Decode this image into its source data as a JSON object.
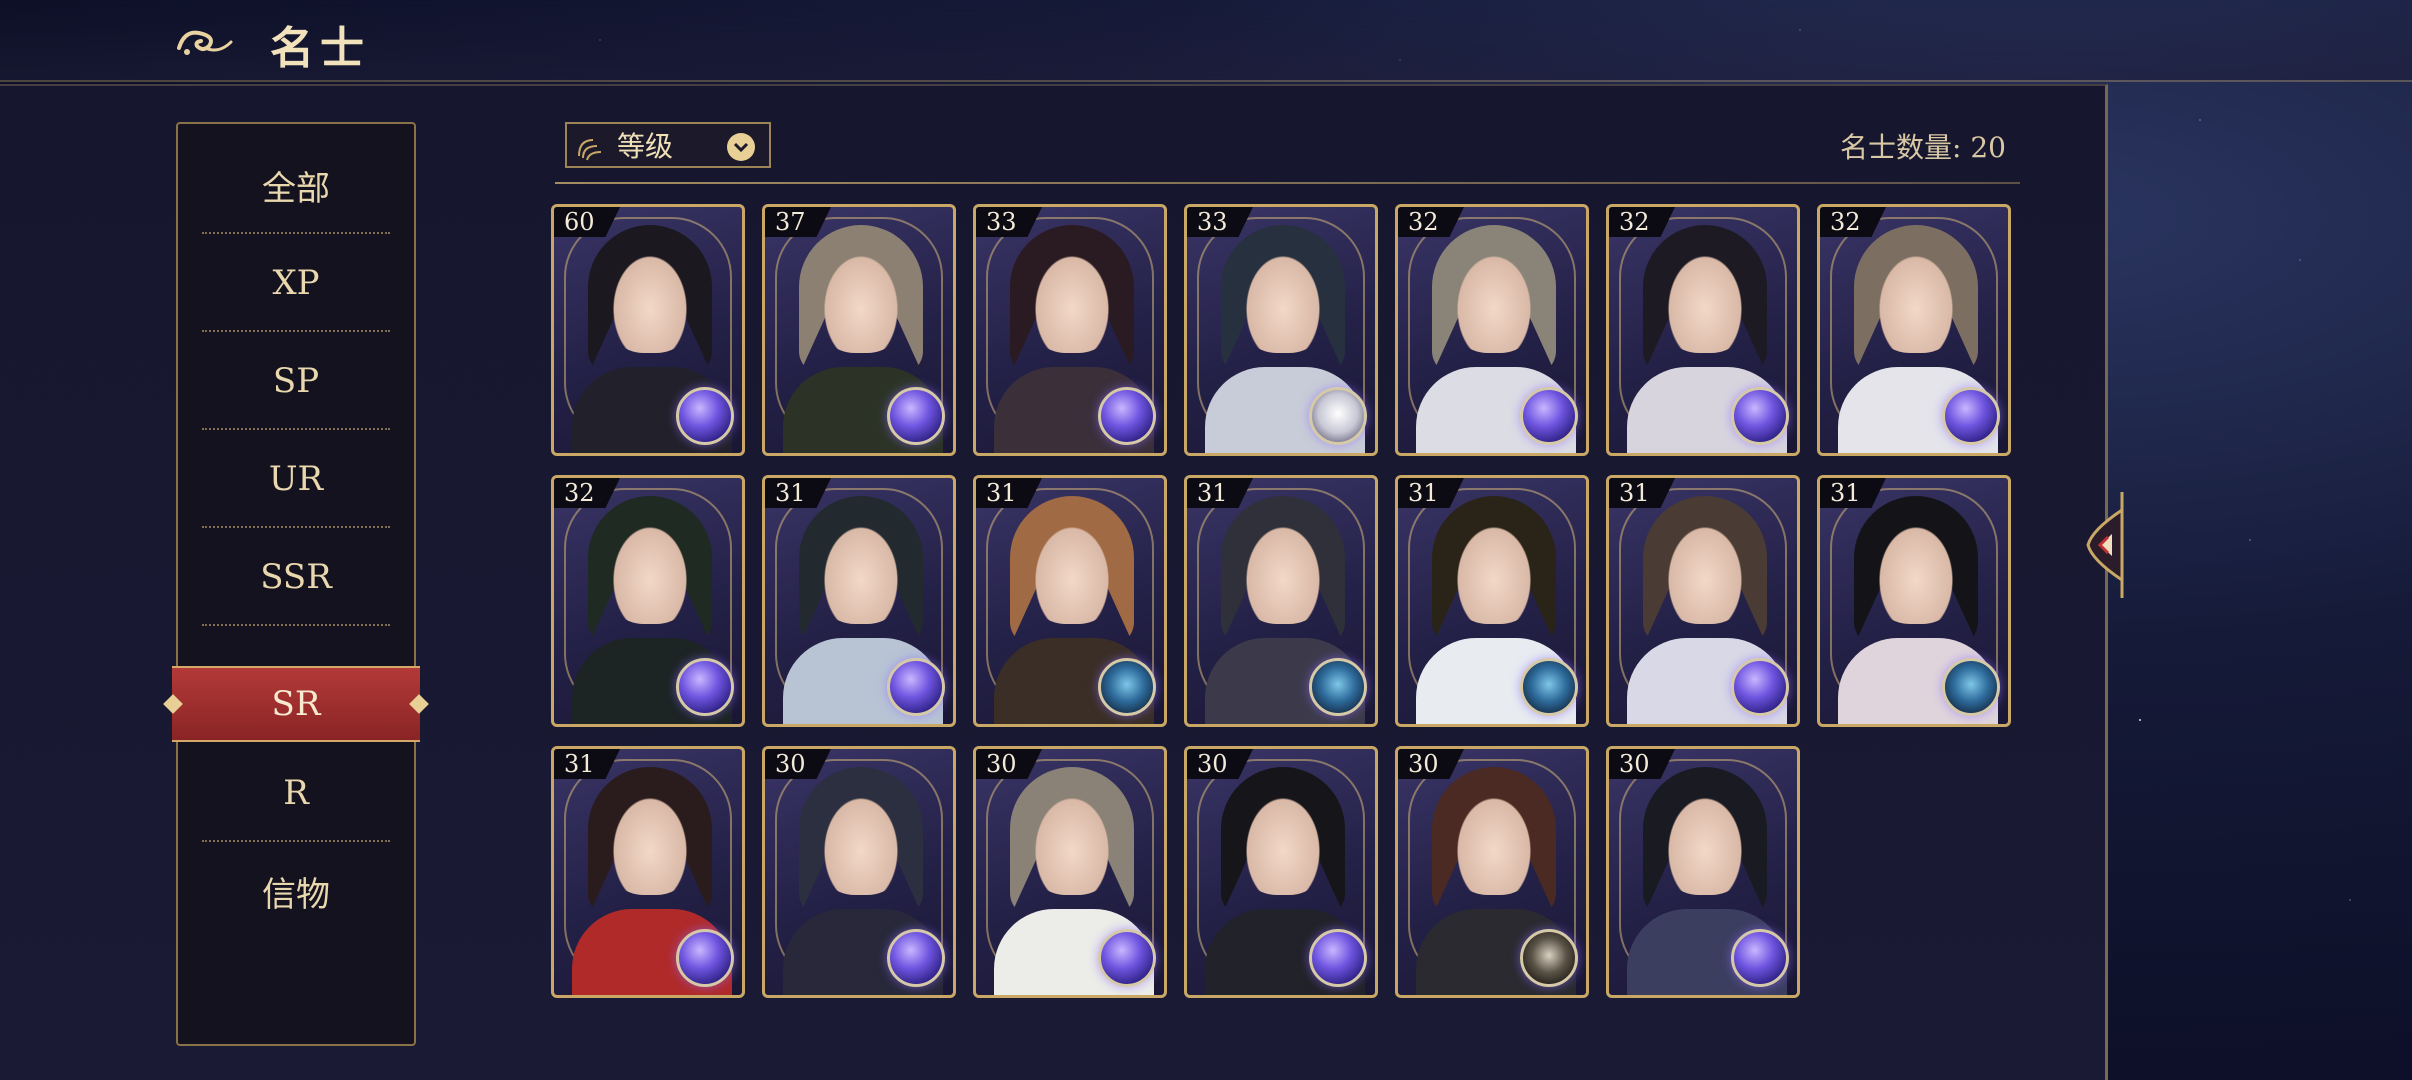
{
  "header": {
    "title": "名士"
  },
  "sidebar": {
    "items": [
      {
        "label": "全部"
      },
      {
        "label": "XP"
      },
      {
        "label": "SP"
      },
      {
        "label": "UR"
      },
      {
        "label": "SSR"
      },
      {
        "label": "SR",
        "active": true
      },
      {
        "label": "R"
      },
      {
        "label": "信物"
      }
    ]
  },
  "toolbar": {
    "sort_label": "等级",
    "count_label": "名士数量: 20"
  },
  "cards": [
    {
      "level": "60",
      "hair": "#1b1820",
      "cloth": "#22202a",
      "orb": "purple"
    },
    {
      "level": "37",
      "hair": "#8b8072",
      "cloth": "#2c3326",
      "orb": "purple"
    },
    {
      "level": "33",
      "hair": "#2a1a22",
      "cloth": "#3b2f3a",
      "orb": "purple"
    },
    {
      "level": "33",
      "hair": "#26303f",
      "cloth": "#c8ccd8",
      "orb": "white"
    },
    {
      "level": "32",
      "hair": "#8a8478",
      "cloth": "#dcdce4",
      "orb": "purple"
    },
    {
      "level": "32",
      "hair": "#1d1a24",
      "cloth": "#d8d4de",
      "orb": "purple"
    },
    {
      "level": "32",
      "hair": "#7c6f62",
      "cloth": "#e4e4ea",
      "orb": "purple"
    },
    {
      "level": "32",
      "hair": "#1e2a22",
      "cloth": "#1c2424",
      "orb": "purple"
    },
    {
      "level": "31",
      "hair": "#222a30",
      "cloth": "#b8c4d4",
      "orb": "purple"
    },
    {
      "level": "31",
      "hair": "#a06a44",
      "cloth": "#3a2e26",
      "orb": "teal"
    },
    {
      "level": "31",
      "hair": "#30303a",
      "cloth": "#3c3a4a",
      "orb": "teal"
    },
    {
      "level": "31",
      "hair": "#2a2418",
      "cloth": "#e8ecf0",
      "orb": "teal"
    },
    {
      "level": "31",
      "hair": "#4a3c34",
      "cloth": "#d8d8e6",
      "orb": "purple"
    },
    {
      "level": "31",
      "hair": "#141418",
      "cloth": "#e0d4dc",
      "orb": "teal"
    },
    {
      "level": "31",
      "hair": "#2a1c1c",
      "cloth": "#b02a2a",
      "orb": "purple"
    },
    {
      "level": "30",
      "hair": "#2c2f40",
      "cloth": "#28283a",
      "orb": "purple"
    },
    {
      "level": "30",
      "hair": "#8a8276",
      "cloth": "#ecece8",
      "orb": "purple"
    },
    {
      "level": "30",
      "hair": "#16151a",
      "cloth": "#22222a",
      "orb": "purple"
    },
    {
      "level": "30",
      "hair": "#4a2a22",
      "cloth": "#2a2a30",
      "orb": "dark"
    },
    {
      "level": "30",
      "hair": "#1a1a22",
      "cloth": "#3c3e60",
      "orb": "purple"
    }
  ],
  "colors": {
    "gold": "#c9a866",
    "active_tab": "#a0302e",
    "panel": "#16162e"
  }
}
